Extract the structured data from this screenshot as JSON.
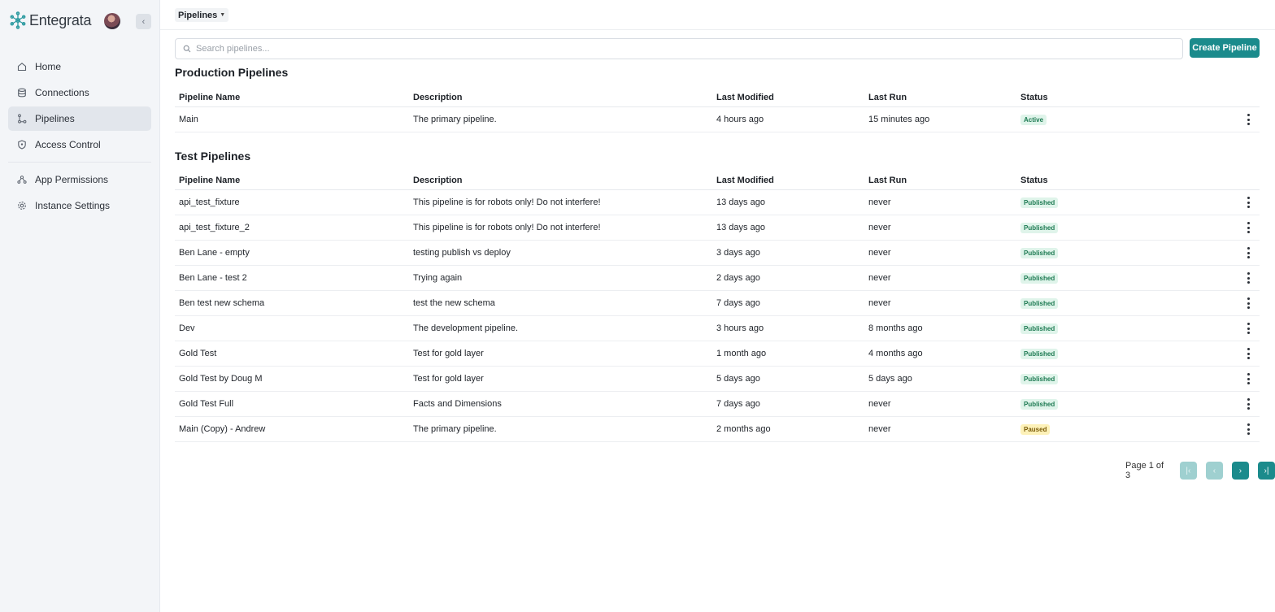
{
  "app": {
    "name": "Entegrata",
    "accent": "#1b8b8c"
  },
  "sidebar": {
    "items": [
      {
        "label": "Home",
        "icon": "home-icon"
      },
      {
        "label": "Connections",
        "icon": "database-icon"
      },
      {
        "label": "Pipelines",
        "icon": "pipeline-icon",
        "active": true
      },
      {
        "label": "Access Control",
        "icon": "shield-icon"
      },
      {
        "label": "App Permissions",
        "icon": "permissions-icon"
      },
      {
        "label": "Instance Settings",
        "icon": "gear-icon"
      }
    ]
  },
  "header": {
    "breadcrumb": "Pipelines"
  },
  "search": {
    "placeholder": "Search pipelines..."
  },
  "actions": {
    "create_label": "Create Pipeline"
  },
  "columns": [
    "Pipeline Name",
    "Description",
    "Last Modified",
    "Last Run",
    "Status"
  ],
  "production": {
    "title": "Production Pipelines",
    "rows": [
      {
        "name": "Main",
        "description": "The primary pipeline.",
        "modified": "4 hours ago",
        "last_run": "15 minutes ago",
        "status": "Active"
      }
    ]
  },
  "test": {
    "title": "Test Pipelines",
    "rows": [
      {
        "name": "api_test_fixture",
        "description": "This pipeline is for robots only! Do not interfere!",
        "modified": "13 days ago",
        "last_run": "never",
        "status": "Published"
      },
      {
        "name": "api_test_fixture_2",
        "description": "This pipeline is for robots only! Do not interfere!",
        "modified": "13 days ago",
        "last_run": "never",
        "status": "Published"
      },
      {
        "name": "Ben Lane - empty",
        "description": "testing publish vs deploy",
        "modified": "3 days ago",
        "last_run": "never",
        "status": "Published"
      },
      {
        "name": "Ben Lane - test 2",
        "description": "Trying again",
        "modified": "2 days ago",
        "last_run": "never",
        "status": "Published"
      },
      {
        "name": "Ben test new schema",
        "description": "test the new schema",
        "modified": "7 days ago",
        "last_run": "never",
        "status": "Published"
      },
      {
        "name": "Dev",
        "description": "The development pipeline.",
        "modified": "3 hours ago",
        "last_run": "8 months ago",
        "status": "Published"
      },
      {
        "name": "Gold Test",
        "description": "Test for gold layer",
        "modified": "1 month ago",
        "last_run": "4 months ago",
        "status": "Published"
      },
      {
        "name": "Gold Test by Doug M",
        "description": "Test for gold layer",
        "modified": "5 days ago",
        "last_run": "5 days ago",
        "status": "Published"
      },
      {
        "name": "Gold Test Full",
        "description": "Facts and Dimensions",
        "modified": "7 days ago",
        "last_run": "never",
        "status": "Published"
      },
      {
        "name": "Main (Copy) - Andrew",
        "description": "The primary pipeline.",
        "modified": "2 months ago",
        "last_run": "never",
        "status": "Paused"
      }
    ]
  },
  "pagination": {
    "label": "Page 1 of 3"
  }
}
